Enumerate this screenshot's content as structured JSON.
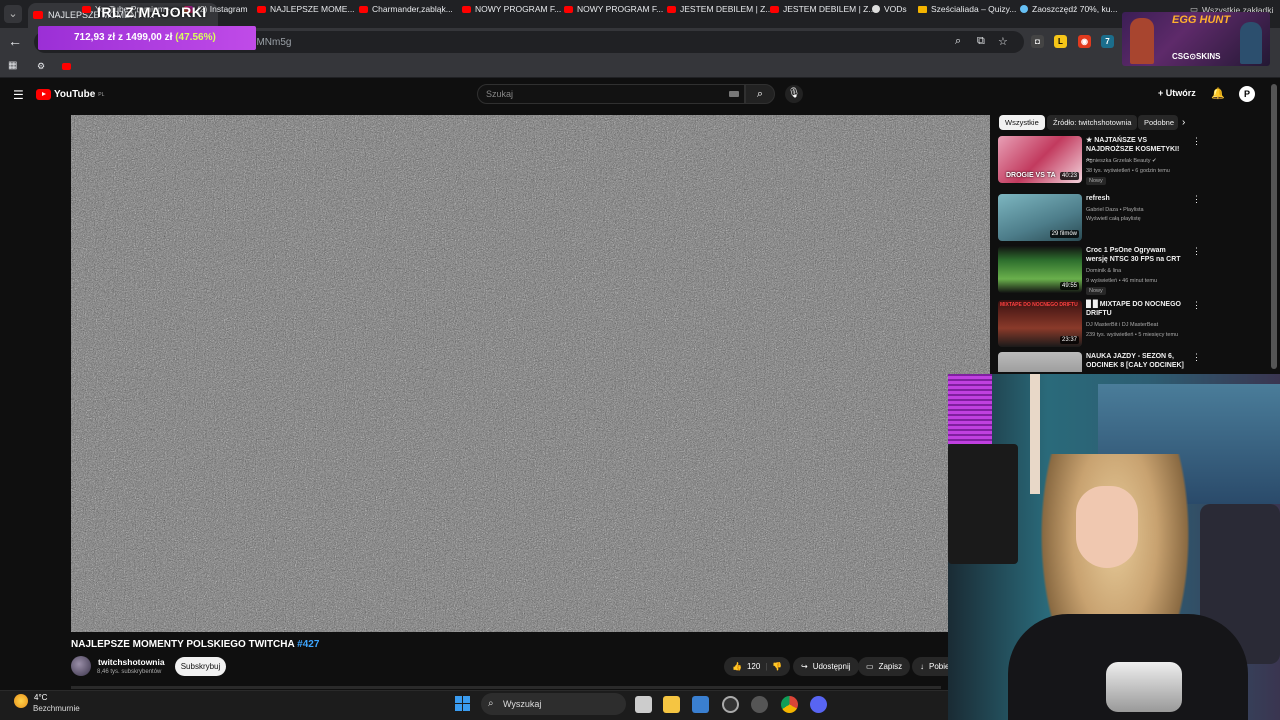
{
  "browser": {
    "tab_title": "NAJLEPSZE MOMENTY...",
    "url_fragment": "Dfb-2MNm5g",
    "bookmarks": [
      {
        "label": "YouTube Premium -...",
        "icon": "youtube-icon"
      },
      {
        "label": "(2) Instagram",
        "icon": "instagram-icon"
      },
      {
        "label": "NAJLEPSZE MOME...",
        "icon": "youtube-icon"
      },
      {
        "label": "Charmander,zabląk...",
        "icon": "youtube-icon"
      },
      {
        "label": "NOWY PROGRAM F...",
        "icon": "youtube-icon"
      },
      {
        "label": "NOWY PROGRAM F...",
        "icon": "youtube-icon"
      },
      {
        "label": "JESTEM DEBILEM | Z...",
        "icon": "youtube-icon"
      },
      {
        "label": "JESTEM DEBILEM | Z...",
        "icon": "youtube-icon"
      },
      {
        "label": "VODs",
        "icon": "globe-icon"
      },
      {
        "label": "Sześcialiada – Quizy...",
        "icon": "quiz-icon"
      },
      {
        "label": "Zaoszczędź 70%, ku...",
        "icon": "steam-icon"
      }
    ],
    "all_bookmarks": "Wszystkie zakładki"
  },
  "overlay": {
    "stream_title": "IRL Z MAJORKI",
    "price_current": "712,93 zł",
    "price_sep": "z",
    "price_goal": "1499,00 zł",
    "price_pct": "(47.56%)",
    "egg_hunt": "EGG HUNT",
    "egg_sponsor": "CSG⊙SKINS"
  },
  "youtube": {
    "logo": "YouTube",
    "logo_region": "PL",
    "search_placeholder": "Szukaj",
    "create_label": "Utwórz",
    "avatar_letter": "P",
    "video": {
      "title": "NAJLEPSZE MOMENTY POLSKIEGO TWITCHA",
      "hashtag": "#427",
      "channel": "twitchshotownia",
      "subscribers": "8,46 tys. subskrybentów",
      "subscribe_label": "Subskrybuj",
      "likes": "120",
      "share_label": "Udostępnij",
      "save_label": "Zapisz",
      "download_label": "Pobie"
    },
    "chips": [
      "Wszystkie",
      "Źródło: twitchshotownia",
      "Podobne"
    ],
    "recommendations": [
      {
        "title": "★ NAJTAŃSZE VS NAJDROŻSZE KOSMETYKI! ...",
        "channel": "Agnieszka Grzelak Beauty ✔",
        "meta": "38 tys. wyświetleń • 6 godzin temu",
        "badge": "Nowy",
        "duration": "40:23",
        "thumb_text": "DROGIE VS TA",
        "thumb_color": "#c23a5e"
      },
      {
        "title": "refresh",
        "channel": "Gabriel Daza • Playlista",
        "meta": "Wyświetl całą playlistę",
        "badge": "",
        "duration": "29 filmów",
        "thumb_text": "",
        "thumb_color": "#4d7d8a"
      },
      {
        "title": "Croc 1 PsOne Ogrywam wersję NTSC 30 FPS na CRT",
        "channel": "Dominik & lina",
        "meta": "9 wyświetleń • 46 minut temu",
        "badge": "Nowy",
        "duration": "49:55",
        "thumb_text": "",
        "thumb_color": "#3c7f3c"
      },
      {
        "title": "█ █ MIXTAPE DO NOCNEGO DRIFTU",
        "channel": "DJ MasterBit i DJ MasterBeat",
        "meta": "239 tys. wyświetleń • 5 miesięcy temu",
        "badge": "",
        "duration": "23:37",
        "thumb_text": "MIXTAPE DO NOCNEGO DRIFTU",
        "thumb_color": "#6a2a2a"
      },
      {
        "title": "NAUKA JAZDY - SEZON 6, ODCINEK 8 [CAŁY ODCINEK] 🚗",
        "channel": "",
        "meta": "",
        "badge": "",
        "duration": "",
        "thumb_text": "",
        "thumb_color": "#8a8a8a"
      }
    ]
  },
  "taskbar": {
    "temp": "4°C",
    "weather": "Bezchmurnie",
    "search_label": "Wyszukaj"
  }
}
